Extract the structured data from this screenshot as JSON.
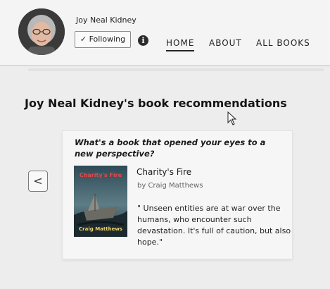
{
  "header": {
    "author_name": "Joy Neal Kidney",
    "follow_label": "✓ Following",
    "info_icon_glyph": "i",
    "nav": [
      {
        "label": "HOME",
        "active": true
      },
      {
        "label": "ABOUT",
        "active": false
      },
      {
        "label": "ALL BOOKS",
        "active": false
      }
    ]
  },
  "main": {
    "section_title": "Joy Neal Kidney's book recommendations",
    "prev_glyph": "<",
    "recommendation": {
      "question": "What's a book that opened your eyes to a new perspective?",
      "book_title": "Charity's Fire",
      "book_author": "by Craig Matthews",
      "quote": "\" Unseen entities are at war over the humans, who encounter such devastation. It's full of caution, but also hope.\"",
      "cover": {
        "title": "Charity's Fire",
        "author": "Craig Matthews"
      }
    }
  },
  "colors": {
    "accent_text": "#222222",
    "cover_title": "#e24a4a",
    "cover_author": "#f3d46a"
  }
}
